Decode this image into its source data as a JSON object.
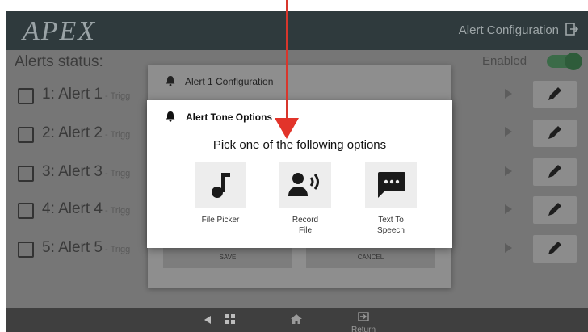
{
  "header": {
    "logo": "APEX",
    "title": "Alert Configuration",
    "icon": "logout-icon"
  },
  "status": {
    "label": "Alerts status:",
    "enabled_label": "Enabled",
    "enabled": true
  },
  "alerts": [
    {
      "num": "1: Alert 1",
      "trig": " - Trigg"
    },
    {
      "num": "2: Alert 2",
      "trig": " - Trigg"
    },
    {
      "num": "3: Alert 3",
      "trig": " - Trigg"
    },
    {
      "num": "4: Alert 4",
      "trig": " - Trigg"
    },
    {
      "num": "5: Alert 5",
      "trig": " - Trigg"
    }
  ],
  "config_dialog": {
    "title": "Alert 1 Configuration",
    "save": "SAVE",
    "cancel": "CANCEL"
  },
  "tone_dialog": {
    "title": "Alert Tone Options",
    "prompt": "Pick one of the following options",
    "options": [
      {
        "label": "File Picker",
        "icon": "music-note-icon"
      },
      {
        "label": "Record\nFile",
        "icon": "voice-record-icon"
      },
      {
        "label": "Text To\nSpeech",
        "icon": "chat-bubble-icon"
      }
    ]
  },
  "nav": {
    "return_label": "Return"
  },
  "colors": {
    "topbar": "#2f3a3d",
    "pointer": "#e2342a",
    "toggle": "#3b6b48"
  }
}
